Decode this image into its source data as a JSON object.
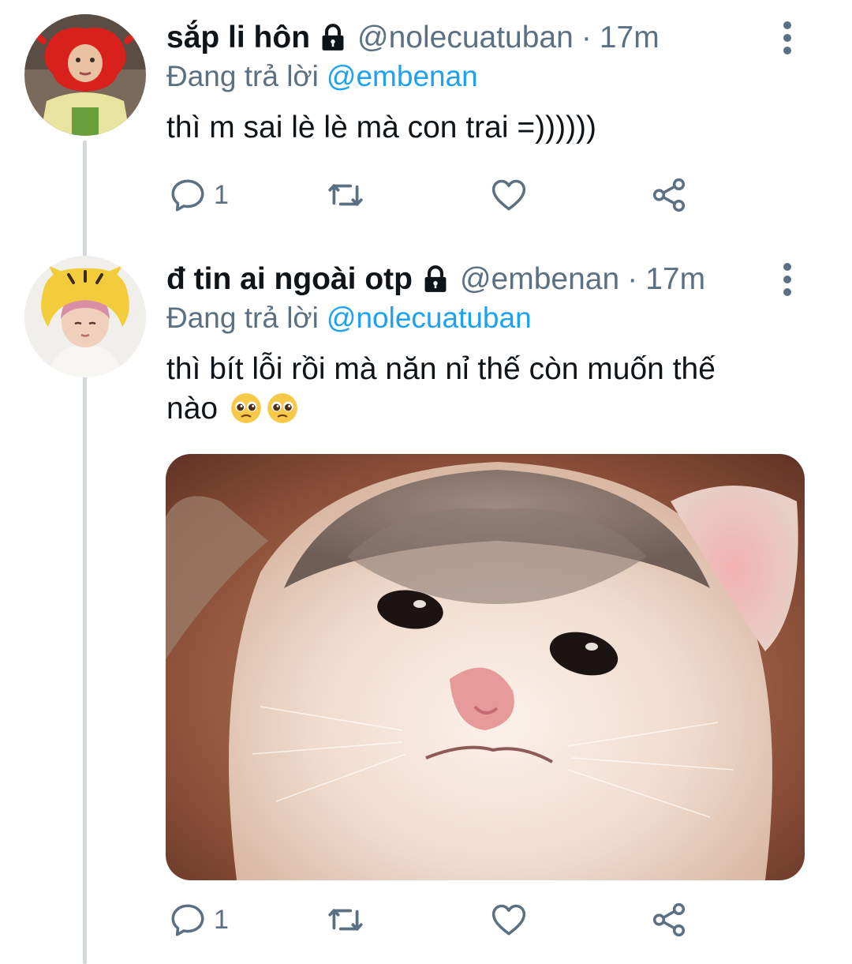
{
  "tweets": [
    {
      "name": "sắp li hôn",
      "handle": "@nolecuatuban",
      "separator": "·",
      "time": "17m",
      "reply_prefix": "Đang trả lời",
      "reply_to": "@embenan",
      "text": "thì m sai lè lè mà con trai =))))))",
      "reply_count": "1"
    },
    {
      "name": "đ tin ai ngoài otp",
      "handle": "@embenan",
      "separator": "·",
      "time": "17m",
      "reply_prefix": "Đang trả lời",
      "reply_to": "@nolecuatuban",
      "text": "thì bít lỗi rồi mà năn nỉ thế còn muốn thế nào",
      "reply_count": "1"
    }
  ],
  "icons": {
    "lock": "lock-icon",
    "more": "more-vertical-icon",
    "reply": "reply-icon",
    "retweet": "retweet-icon",
    "like": "heart-icon",
    "share": "share-icon",
    "emoji": "pleading-face-emoji"
  },
  "colors": {
    "text_primary": "#0f1419",
    "text_secondary": "#5b7083",
    "link": "#1da1f2",
    "thread_line": "#d4d9dd"
  }
}
